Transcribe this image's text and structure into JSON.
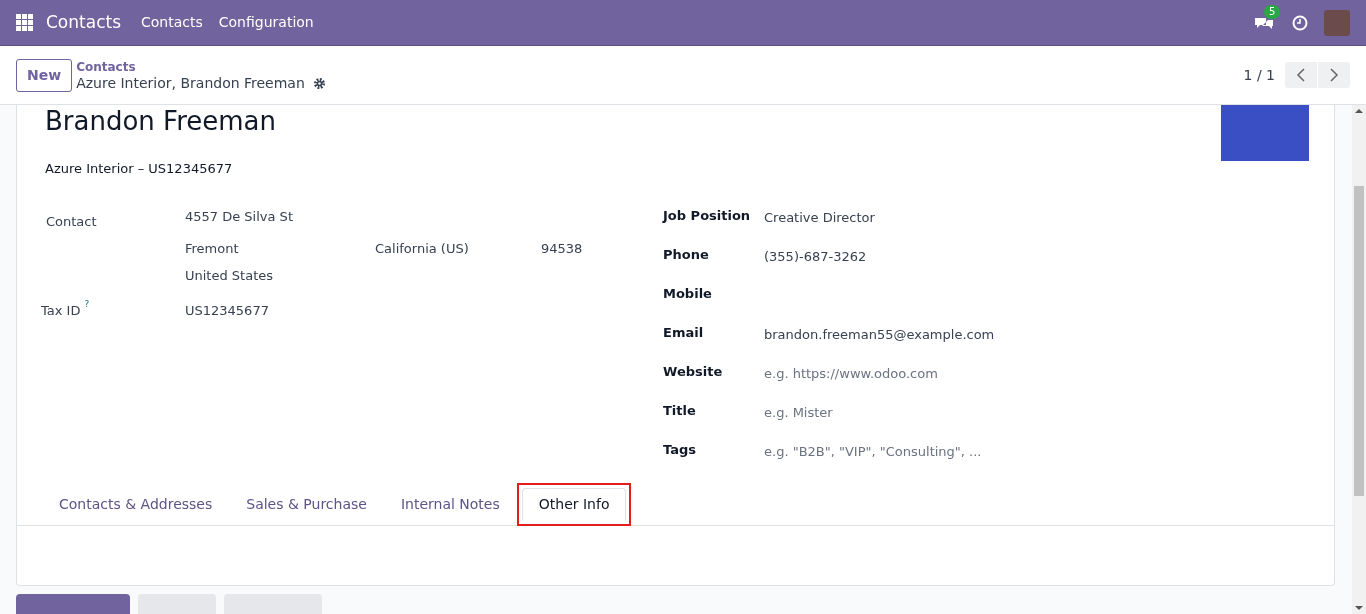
{
  "navbar": {
    "app": "Contacts",
    "menus": [
      "Contacts",
      "Configuration"
    ],
    "messages_badge": "5"
  },
  "control_panel": {
    "new_button": "New",
    "breadcrumb": "Contacts",
    "record": "Azure Interior, Brandon Freeman",
    "pager": "1 / 1"
  },
  "form": {
    "name": "Brandon Freeman",
    "company": "Azure Interior – US12345677",
    "address": {
      "label": "Contact",
      "street": "4557 De Silva St",
      "city": "Fremont",
      "state": "California (US)",
      "zip": "94538",
      "country": "United States"
    },
    "tax_id": {
      "label": "Tax ID",
      "help": "?",
      "value": "US12345677"
    },
    "right_fields": [
      {
        "label": "Job Position",
        "value": "Creative Director"
      },
      {
        "label": "Phone",
        "value": "(355)-687-3262"
      },
      {
        "label": "Mobile"
      },
      {
        "label": "Email",
        "value": "brandon.freeman55@example.com"
      },
      {
        "label": "Website",
        "placeholder": "e.g. https://www.odoo.com"
      },
      {
        "label": "Title",
        "placeholder": "e.g. Mister"
      },
      {
        "label": "Tags",
        "placeholder": "e.g. \"B2B\", \"VIP\", \"Consulting\", ..."
      }
    ],
    "tabs": [
      {
        "label": "Contacts & Addresses",
        "selected": false,
        "highlighted": false
      },
      {
        "label": "Sales & Purchase",
        "selected": false,
        "highlighted": false
      },
      {
        "label": "Internal Notes",
        "selected": false,
        "highlighted": false
      },
      {
        "label": "Other Info",
        "selected": true,
        "highlighted": true
      }
    ]
  }
}
